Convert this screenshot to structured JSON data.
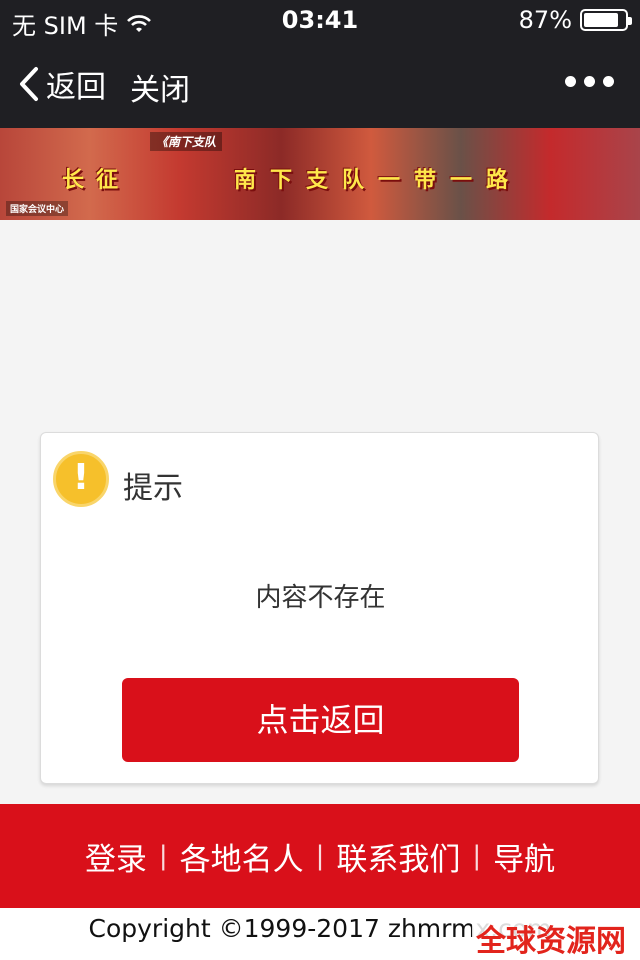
{
  "status_bar": {
    "carrier": "无 SIM 卡",
    "time": "03:41",
    "battery": "87%",
    "battery_level": 0.87
  },
  "nav": {
    "back_label": "返回",
    "close_label": "关闭"
  },
  "banner": {
    "tag": "《南下支队",
    "slogan_left": "长征",
    "slogan_right": "南下支队一带一路",
    "logo_text": "国家会议中心"
  },
  "dialog": {
    "title": "提示",
    "message": "内容不存在",
    "button_label": "点击返回",
    "icon": "alert-icon"
  },
  "footer": {
    "links": [
      "登录",
      "各地名人",
      "联系我们",
      "导航"
    ],
    "separator": "|",
    "copyright": "Copyright ©1999-2017 zhmrmx.com",
    "watermark": "全球资源网"
  },
  "colors": {
    "accent_red": "#d9101a",
    "alert_yellow": "#f6c02b",
    "topbar": "#1f1f23"
  }
}
